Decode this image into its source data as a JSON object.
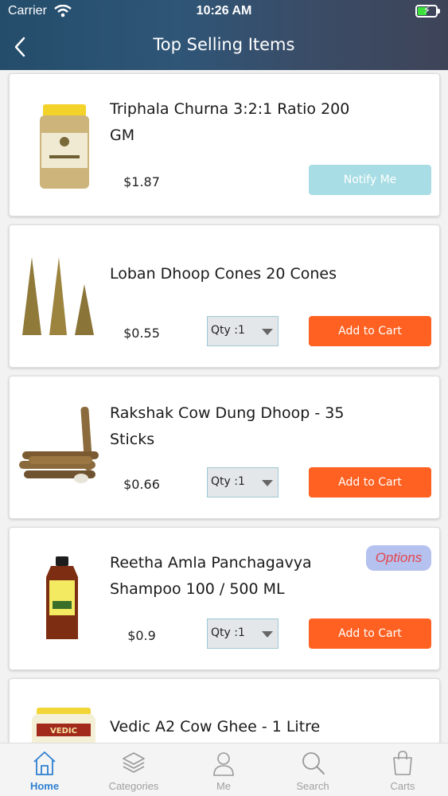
{
  "status_bar": {
    "carrier": "Carrier",
    "time": "10:26 AM",
    "battery_level": 0.5
  },
  "nav": {
    "title": "Top Selling Items"
  },
  "products": [
    {
      "name": "Triphala Churna 3:2:1 Ratio 200 GM",
      "price": "$1.87",
      "action": "Notify Me",
      "image": "jar-icon"
    },
    {
      "name": "Loban Dhoop Cones 20 Cones",
      "price": "$0.55",
      "qty": "Qty :1",
      "action": "Add to Cart",
      "image": "dhoop-cones-icon"
    },
    {
      "name": "Rakshak Cow Dung Dhoop - 35 Sticks",
      "price": "$0.66",
      "qty": "Qty :1",
      "action": "Add to Cart",
      "image": "dhoop-sticks-icon"
    },
    {
      "name": "Reetha Amla Panchagavya Shampoo 100 / 500 ML",
      "price": "$0.9",
      "qty": "Qty :1",
      "action": "Add to Cart",
      "options": "Options",
      "image": "shampoo-bottle-icon"
    },
    {
      "name": "Vedic A2 Cow Ghee - 1 Litre",
      "image": "ghee-jar-icon"
    }
  ],
  "tabs": [
    {
      "label": "Home",
      "icon": "home-icon",
      "active": true
    },
    {
      "label": "Categories",
      "icon": "layers-icon"
    },
    {
      "label": "Me",
      "icon": "user-icon"
    },
    {
      "label": "Search",
      "icon": "search-icon"
    },
    {
      "label": "Carts",
      "icon": "bag-icon"
    }
  ],
  "colors": {
    "add_to_cart": "#fe6121",
    "notify_me": "#a9dde5",
    "active_tab": "#2f7fd0",
    "options_text": "#e5454c"
  }
}
